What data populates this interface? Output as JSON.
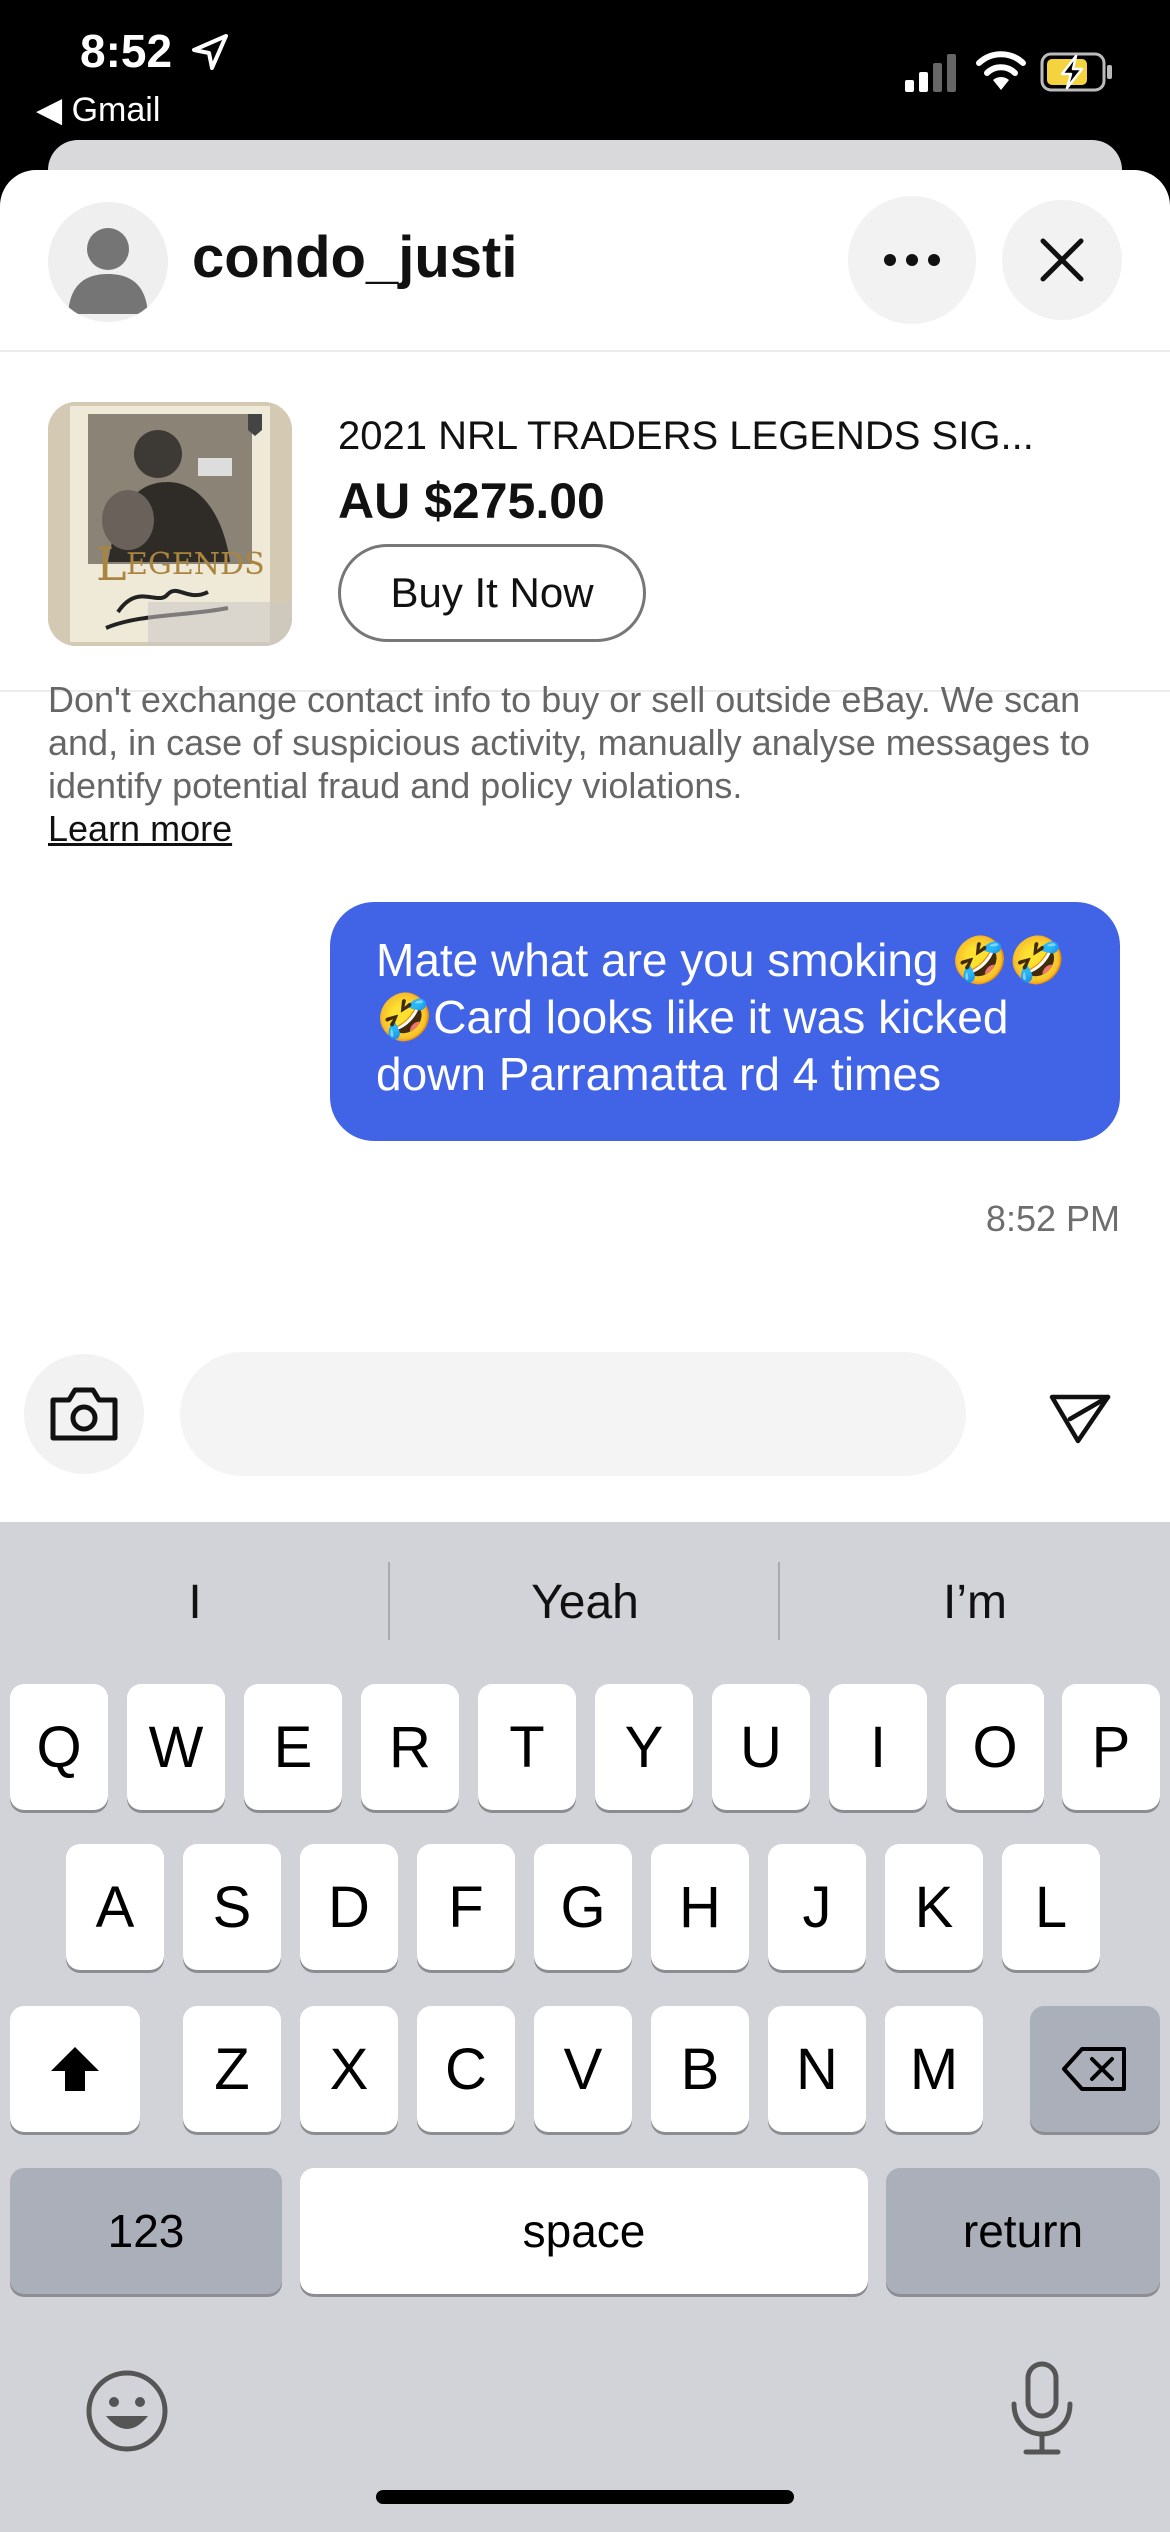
{
  "status_bar": {
    "time": "8:52",
    "back_app": "◀ Gmail"
  },
  "chat": {
    "username": "condo_justi",
    "listing": {
      "title": "2021 NRL TRADERS LEGENDS SIG...",
      "price": "AU $275.00",
      "buy_label": "Buy It Now"
    },
    "notice": "Don't exchange contact info to buy or sell outside eBay. We scan and, in case of suspicious activity, manually analyse messages to identify potential fraud and policy violations.",
    "learn_more": "Learn more",
    "messages": [
      {
        "text": "Mate what are you smoking 🤣🤣🤣Card looks like it was kicked down Parramatta rd 4 times",
        "time": "8:52 PM",
        "sent": true
      }
    ],
    "input": {
      "value": "",
      "placeholder": ""
    }
  },
  "keyboard": {
    "suggestions": [
      "I",
      "Yeah",
      "I’m"
    ],
    "rows": [
      [
        "Q",
        "W",
        "E",
        "R",
        "T",
        "Y",
        "U",
        "I",
        "O",
        "P"
      ],
      [
        "A",
        "S",
        "D",
        "F",
        "G",
        "H",
        "J",
        "K",
        "L"
      ],
      [
        "Z",
        "X",
        "C",
        "V",
        "B",
        "N",
        "M"
      ]
    ],
    "numbers_label": "123",
    "space_label": "space",
    "return_label": "return"
  },
  "colors": {
    "bubble": "#4163e6",
    "keyboard_bg": "#d1d3d9"
  }
}
